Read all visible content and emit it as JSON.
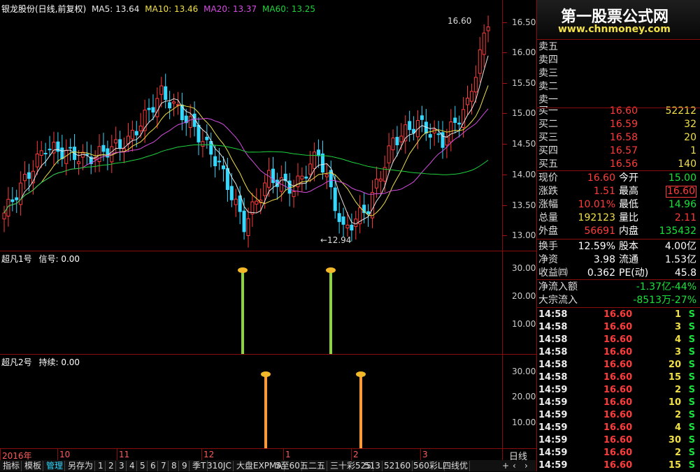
{
  "banner": {
    "title": "第一股票公式网",
    "url": "www.chnmoney.com"
  },
  "main_chart": {
    "header": {
      "name": "银龙股份(日线,前复权)",
      "ma5": "MA5: 13.64",
      "ma10": "MA10: 13.46",
      "ma20": "MA20: 13.37",
      "ma60": "MA60: 13.25"
    },
    "high_label": "16.60",
    "low_label": "12.94",
    "ticks": [
      "16.50",
      "16.00",
      "15.50",
      "15.00",
      "14.50",
      "14.00",
      "13.50",
      "13.00"
    ],
    "colors": {
      "up": "#ff3b3b",
      "down": "#35d8ff",
      "ma5": "#e8e8e8",
      "ma10": "#f1e047",
      "ma20": "#d44de0",
      "ma60": "#1fd23d"
    }
  },
  "ind1": {
    "title": "超凡1号",
    "label": "信号: 0.00",
    "ticks": [
      "30.00",
      "20.00",
      "10.00"
    ]
  },
  "ind2": {
    "title": "超凡2号",
    "label": "持续: 0.00",
    "ticks": [
      "30.00",
      "20.00",
      "10.00"
    ]
  },
  "date_axis": {
    "labels": [
      "2016年",
      "10",
      "11",
      "12",
      "1",
      "2",
      "3"
    ]
  },
  "bottom_tabs": [
    "指标",
    "模板",
    "管理",
    "另存为",
    "1",
    "2",
    "3",
    "4",
    "5",
    "6",
    "7",
    "8",
    "9",
    "季T",
    "310JC",
    "大盘EXPMA",
    "5至60",
    "五二五",
    "三十彩525",
    "513",
    "52160",
    "560彩L",
    "四线优"
  ],
  "period": "日线",
  "order_book": {
    "sell": [
      {
        "label": "卖五"
      },
      {
        "label": "卖四"
      },
      {
        "label": "卖三"
      },
      {
        "label": "卖二"
      },
      {
        "label": "卖一"
      }
    ],
    "buy": [
      {
        "label": "买一",
        "price": "16.60",
        "vol": "52212"
      },
      {
        "label": "买二",
        "price": "16.59",
        "vol": "32"
      },
      {
        "label": "买三",
        "price": "16.58",
        "vol": "20"
      },
      {
        "label": "买四",
        "price": "16.57",
        "vol": "1"
      },
      {
        "label": "买五",
        "price": "16.56",
        "vol": "140"
      }
    ]
  },
  "quote": {
    "xianjia_l": "现价",
    "xianjia": "16.60",
    "jinkai_l": "今开",
    "jinkai": "15.00",
    "zhangdie_l": "涨跌",
    "zhangdie": "1.51",
    "zuigao_l": "最高",
    "zuigao": "16.60",
    "zhangfu_l": "涨幅",
    "zhangfu": "10.01%",
    "zuidi_l": "最低",
    "zuidi": "14.96",
    "zongliang_l": "总量",
    "zongliang": "192123",
    "liangbi_l": "量比",
    "liangbi": "2.11",
    "waipan_l": "外盘",
    "waipan": "56691",
    "neipan_l": "内盘",
    "neipan": "135432",
    "huanshou_l": "换手",
    "huanshou": "12.59%",
    "guben_l": "股本",
    "guben": "4.00亿",
    "jingzi_l": "净资",
    "jingzi": "3.98",
    "liutong_l": "流通",
    "liutong": "1.53亿",
    "shouyi_l": "收益㈣",
    "shouyi": "0.362",
    "pe_l": "PE(动)",
    "pe": "45.8",
    "jingliuru_l": "净流入额",
    "jingliuru": "-1.37亿",
    "jingliuru_pct": "-44%",
    "dazong_l": "大宗流入",
    "dazong": "-8513万",
    "dazong_pct": "-27%"
  },
  "ticks_list": [
    {
      "time": "14:58",
      "price": "16.60",
      "vol": "1",
      "side": "S"
    },
    {
      "time": "14:58",
      "price": "16.60",
      "vol": "3",
      "side": "S"
    },
    {
      "time": "14:58",
      "price": "16.60",
      "vol": "4",
      "side": "S"
    },
    {
      "time": "14:58",
      "price": "16.60",
      "vol": "3",
      "side": "S"
    },
    {
      "time": "14:58",
      "price": "16.60",
      "vol": "20",
      "side": "S"
    },
    {
      "time": "14:58",
      "price": "16.60",
      "vol": "15",
      "side": "S"
    },
    {
      "time": "14:59",
      "price": "16.60",
      "vol": "2",
      "side": "S"
    },
    {
      "time": "14:59",
      "price": "16.60",
      "vol": "10",
      "side": "S"
    },
    {
      "time": "14:59",
      "price": "16.60",
      "vol": "2",
      "side": "S"
    },
    {
      "time": "14:59",
      "price": "16.60",
      "vol": "4",
      "side": "S"
    },
    {
      "time": "14:59",
      "price": "16.60",
      "vol": "30",
      "side": "S"
    },
    {
      "time": "14:59",
      "price": "16.60",
      "vol": "2",
      "side": "S"
    },
    {
      "time": "14:59",
      "price": "16.60",
      "vol": "15",
      "side": "S"
    }
  ]
}
